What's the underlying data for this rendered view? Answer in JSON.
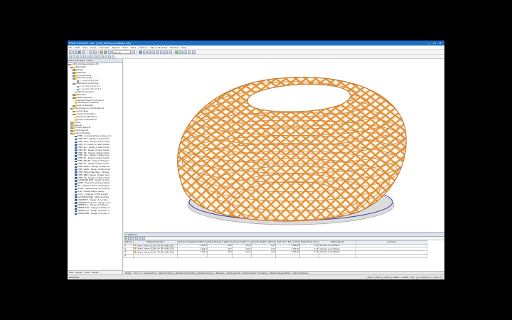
{
  "titlebar": {
    "title": "RFEM 6.03.0001 x64 - [CHR_022Granerollbahn.rf6]",
    "min": "—",
    "max": "☐",
    "close": "✕"
  },
  "menu": [
    "File",
    "Edit",
    "View",
    "Insert",
    "Calculate",
    "Results",
    "Tools",
    "Table",
    "Options",
    "Add-on Modules",
    "Window",
    "Help"
  ],
  "toolbar": {
    "load_case": "LC1 - G"
  },
  "navigator": {
    "title": "Project Navigator - Data",
    "items": [
      {
        "label": "CHR_022Granerollbahn.rf6",
        "icon": "folder",
        "indent": 0,
        "exp": "-"
      },
      {
        "label": "Model Data",
        "icon": "folder",
        "indent": 1,
        "exp": "-"
      },
      {
        "label": "Nodes",
        "icon": "folder",
        "indent": 2,
        "exp": "+"
      },
      {
        "label": "Materials",
        "icon": "folder",
        "indent": 2,
        "exp": "+"
      },
      {
        "label": "Cross-Sections",
        "icon": "folder",
        "indent": 2,
        "exp": "+"
      },
      {
        "label": "Member Hinges",
        "icon": "folder",
        "indent": 2,
        "exp": "+"
      },
      {
        "label": "1 - Local | ddd | ddd",
        "icon": "item",
        "indent": 3,
        "exp": ""
      },
      {
        "label": "Member Eccentricities",
        "icon": "folder",
        "indent": 2,
        "exp": "-"
      },
      {
        "label": "1 - 0, -0.4, 0.3 | 0, 0.3",
        "icon": "item",
        "indent": 3,
        "exp": ""
      },
      {
        "label": "2 - 0, -0.4, -0.3 | 0, 0.3",
        "icon": "item",
        "indent": 3,
        "exp": ""
      },
      {
        "label": "Member Divisions",
        "icon": "folder",
        "indent": 2,
        "exp": ""
      },
      {
        "label": "Members",
        "icon": "folder",
        "indent": 2,
        "exp": "+"
      },
      {
        "label": "Nodal Supports",
        "icon": "folder",
        "indent": 2,
        "exp": "+"
      },
      {
        "label": "Member Elastic Foundations",
        "icon": "folder",
        "indent": 2,
        "exp": ""
      },
      {
        "label": "Member Nonlinearities",
        "icon": "folder",
        "indent": 2,
        "exp": ""
      },
      {
        "label": "Sets of Members",
        "icon": "folder",
        "indent": 2,
        "exp": "+"
      },
      {
        "label": "Load Cases and Combinations",
        "icon": "folder",
        "indent": 1,
        "exp": "-"
      },
      {
        "label": "Load Cases",
        "icon": "folder",
        "indent": 2,
        "exp": "+"
      },
      {
        "label": "Load Combinations",
        "icon": "folder",
        "indent": 2,
        "exp": "+"
      },
      {
        "label": "Result Combinations",
        "icon": "folder",
        "indent": 2,
        "exp": ""
      },
      {
        "label": "Super Combinations",
        "icon": "folder",
        "indent": 2,
        "exp": ""
      },
      {
        "label": "Loads",
        "icon": "folder",
        "indent": 1,
        "exp": "+"
      },
      {
        "label": "Results",
        "icon": "folder",
        "indent": 1,
        "exp": "+"
      },
      {
        "label": "Printout Reports",
        "icon": "folder",
        "indent": 1,
        "exp": "+"
      },
      {
        "label": "Guide Objects",
        "icon": "folder",
        "indent": 1,
        "exp": "+"
      },
      {
        "label": "Add-on Modules",
        "icon": "folder",
        "indent": 1,
        "exp": "-"
      },
      {
        "label": "STEEL - General stress analysis of s",
        "icon": "addon",
        "indent": 2,
        "exp": ""
      },
      {
        "label": "STEEL EC3 - Design of steel mem",
        "icon": "addon",
        "indent": 2,
        "exp": ""
      },
      {
        "label": "STEEL AISC - Design of steel mem",
        "icon": "addon",
        "indent": 2,
        "exp": ""
      },
      {
        "label": "STEEL IS - Design of steel membe",
        "icon": "addon",
        "indent": 2,
        "exp": ""
      },
      {
        "label": "STEEL SIA - Design of steel memb",
        "icon": "addon",
        "indent": 2,
        "exp": ""
      },
      {
        "label": "STEEL BS - Design of steel memb",
        "icon": "addon",
        "indent": 2,
        "exp": ""
      },
      {
        "label": "STEEL GB - Design of steel memb",
        "icon": "addon",
        "indent": 2,
        "exp": ""
      },
      {
        "label": "STEEL CSA - Design of steel mem",
        "icon": "addon",
        "indent": 2,
        "exp": ""
      },
      {
        "label": "STEEL AS - Design of steel memb",
        "icon": "addon",
        "indent": 2,
        "exp": ""
      },
      {
        "label": "STEEL NTC-DF - Design of steel m",
        "icon": "addon",
        "indent": 2,
        "exp": ""
      },
      {
        "label": "STEEL SP - Design of steel memb",
        "icon": "addon",
        "indent": 2,
        "exp": ""
      },
      {
        "label": "STEEL Plastic - Design of steel me",
        "icon": "addon",
        "indent": 2,
        "exp": ""
      },
      {
        "label": "STEEL SANS - Design of steel mem",
        "icon": "addon",
        "indent": 2,
        "exp": ""
      },
      {
        "label": "STEEL Fatigue Members - Fatigue",
        "icon": "addon",
        "indent": 2,
        "exp": ""
      },
      {
        "label": "STEEL NBR - Design of steel mem",
        "icon": "addon",
        "indent": 2,
        "exp": ""
      },
      {
        "label": "STEEL HK - Design of steel memb",
        "icon": "addon",
        "indent": 2,
        "exp": ""
      },
      {
        "label": "ALUMINIUM ADM - Design of alum",
        "icon": "addon",
        "indent": 2,
        "exp": ""
      },
      {
        "label": "KAPPA - Flexural buckling analysis",
        "icon": "addon",
        "indent": 2,
        "exp": ""
      },
      {
        "label": "LTB - Lateral-torsional buckling an",
        "icon": "addon",
        "indent": 2,
        "exp": ""
      },
      {
        "label": "FE-LTB - Lateral-torsional buckling",
        "icon": "addon",
        "indent": 2,
        "exp": ""
      },
      {
        "label": "EL-PL - Elastic-plastic design",
        "icon": "addon",
        "indent": 2,
        "exp": ""
      },
      {
        "label": "C-TO-T - Analysis of limit slender",
        "icon": "addon",
        "indent": 2,
        "exp": ""
      },
      {
        "label": "PLATE-BUCKLING - Plate buckling",
        "icon": "addon",
        "indent": 2,
        "exp": ""
      },
      {
        "label": "CONCRETE - Design of concrete",
        "icon": "addon",
        "indent": 2,
        "exp": ""
      },
      {
        "label": "CONCRETE Columns - Design of co",
        "icon": "addon",
        "indent": 2,
        "exp": ""
      },
      {
        "label": "TIMBER Pro - Design of timber m",
        "icon": "addon",
        "indent": 2,
        "exp": ""
      },
      {
        "label": "TIMBER AWC - Design of timber m",
        "icon": "addon",
        "indent": 2,
        "exp": ""
      },
      {
        "label": "TIMBER CSA - Design of timber m",
        "icon": "addon",
        "indent": 2,
        "exp": ""
      },
      {
        "label": "TIMBER NBR - Design of timber m",
        "icon": "addon",
        "indent": 2,
        "exp": ""
      }
    ],
    "tabs": [
      "Data",
      "Display",
      "Views",
      "Results"
    ]
  },
  "table": {
    "title": "1.3 Materials",
    "headers": [
      "Matl. No.",
      "Material Description",
      "Modulus of Elasticity E [kN/cm²]",
      "Shear Modulus G [kN/cm²]",
      "Poisson's Ratio ν [-]",
      "Specific Weight γ [kN/m³]",
      "Coeff. of Th. Exp. α [1/°C]",
      "Partial Factor γM [-]",
      "Material Model",
      "Comment"
    ],
    "rows": [
      [
        "1",
        "Glulam Timber GL24h | NF EN 14080:2013",
        "1150.0",
        "65.0",
        "7.846",
        "4.20",
        "5.00E-06",
        "1.25",
        "Isotropic Linear Elastic",
        ""
      ],
      [
        "2",
        "Glulam Timber GL28h | NF EN 14080:2013",
        "1260.0",
        "65.0",
        "9.000",
        "4.60",
        "5.00E-06",
        "1.25",
        "Isotropic Linear Elastic",
        ""
      ],
      [
        "3",
        "Glulam Timber GL32h | NF EN 14080:2013",
        "1420.0",
        "65.0",
        "9.923",
        "4.90",
        "5.00E-06",
        "1.25",
        "Isotropic Linear Elastic",
        ""
      ],
      [
        "4",
        "",
        "",
        "",
        "",
        "",
        "",
        "",
        "",
        ""
      ]
    ],
    "tabs": [
      "Nodes",
      "Materials",
      "Cross-Sections",
      "Member Hinges",
      "Member Eccentricities",
      "Member Divisions",
      "Members",
      "Nodal Supports",
      "Member Elastic Foundations",
      "Member Nonlinearities",
      "Sets of Members"
    ],
    "active_tab": "Materials"
  },
  "status": {
    "message": "Workplane",
    "items": [
      "SNAP",
      "GRID",
      "CARTES",
      "OSNAP",
      "GLINES",
      "DXF",
      "CS: Global XYZ",
      "Plane: XY"
    ]
  },
  "colors": {
    "timber": "#e8a04a",
    "titlebar": "#1e6fc4",
    "support": "#3a3aa8"
  }
}
